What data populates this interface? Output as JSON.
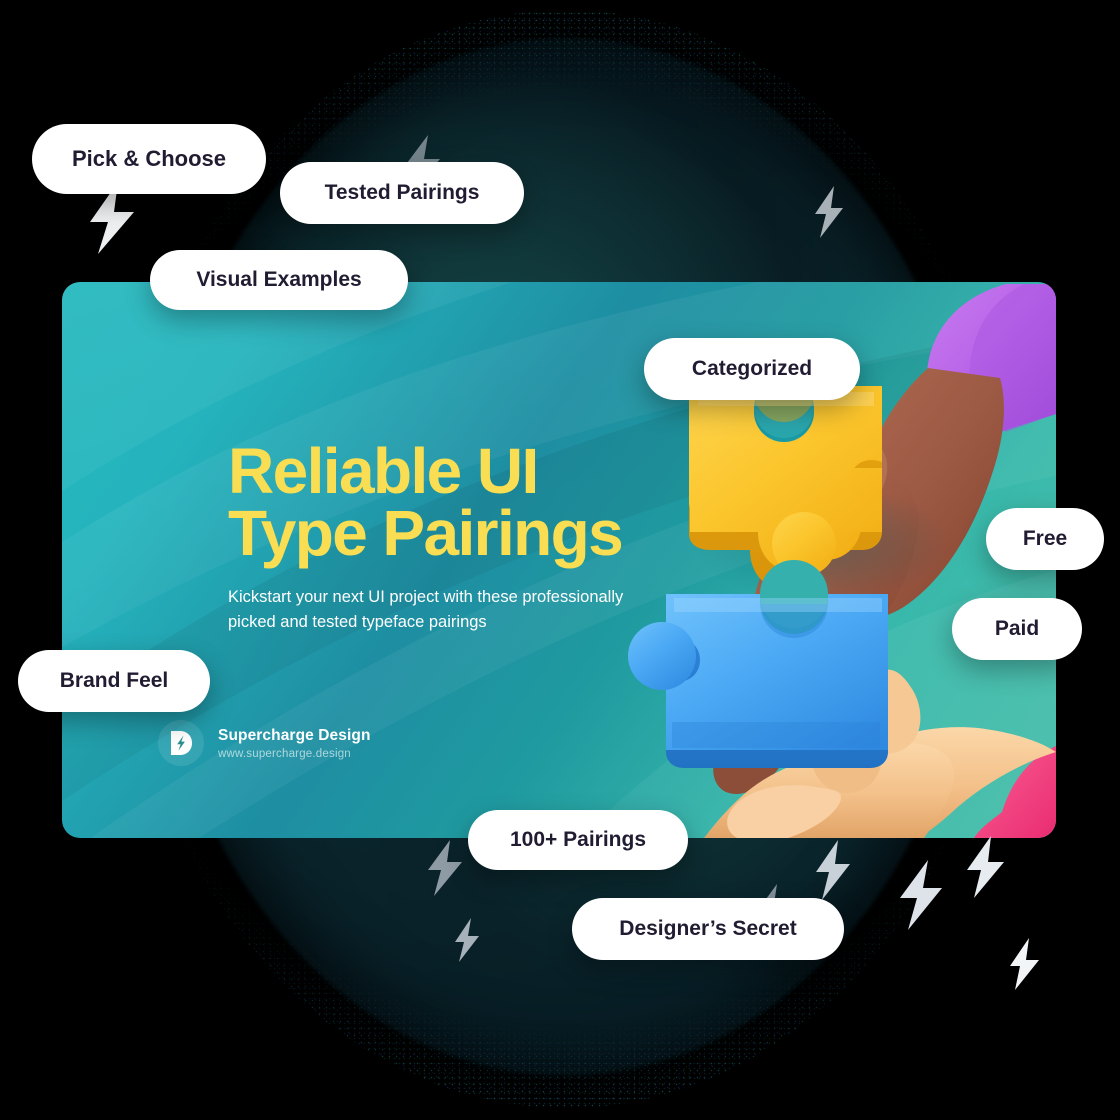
{
  "card": {
    "headline_line1": "Reliable UI",
    "headline_line2": "Type Pairings",
    "subcopy_line1": "Kickstart your next UI project with these professionally",
    "subcopy_line2": "picked and tested typeface pairings",
    "brand_name": "Supercharge Design",
    "brand_url": "www.supercharge.design",
    "brand_icon": "lightning-bolt-d-icon",
    "colors": {
      "headline": "#f9dd52",
      "card_teal_light": "#23b8bd",
      "card_teal_deep": "#1e8ea2",
      "card_green": "#4fc0ac",
      "body_text": "#ffffff",
      "url_text": "rgba(255,255,255,0.62)"
    }
  },
  "pills": [
    {
      "id": "pick-choose",
      "label": "Pick & Choose"
    },
    {
      "id": "tested-pairings",
      "label": "Tested Pairings"
    },
    {
      "id": "visual-examples",
      "label": "Visual Examples"
    },
    {
      "id": "categorized",
      "label": "Categorized"
    },
    {
      "id": "free",
      "label": "Free"
    },
    {
      "id": "paid",
      "label": "Paid"
    },
    {
      "id": "brand-feel",
      "label": "Brand Feel"
    },
    {
      "id": "pairings-count",
      "label": "100+ Pairings"
    },
    {
      "id": "designers-secret",
      "label": "Designer’s Secret"
    }
  ],
  "artwork": {
    "yellow_puzzle_piece": "puzzle-piece-yellow",
    "blue_puzzle_piece": "puzzle-piece-blue",
    "top_hand": "hand-dark-skin-purple-sleeve",
    "bottom_hand": "hand-light-skin-pink-sleeve",
    "colors": {
      "puzzle_yellow": "#fbc226",
      "puzzle_yellow_shadow": "#e29d11",
      "puzzle_blue": "#4aaaf6",
      "puzzle_blue_shadow": "#2f86dd",
      "hand_top": "#a4604b",
      "sleeve_top": "#b863e8",
      "hand_bottom": "#f3c089",
      "sleeve_bottom": "#f0417e"
    }
  },
  "decorations": {
    "bolt_icon": "lightning-bolt-icon",
    "bolt_color": "#e9ecef",
    "glow_color": "#123338",
    "background": "#000000"
  }
}
